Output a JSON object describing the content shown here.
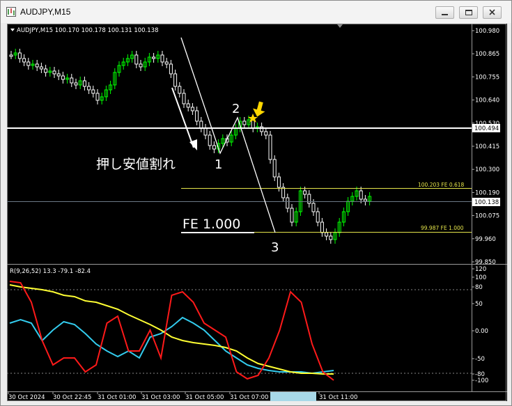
{
  "window": {
    "title": "AUDJPY,M15",
    "buttons": [
      "minimize",
      "maximize",
      "close"
    ]
  },
  "chart": {
    "info_line": "AUDJPY,M15  100.170 100.178 100.131 100.138",
    "price_axis_labels": [
      "100.980",
      "100.865",
      "100.755",
      "100.640",
      "100.530",
      "100.415",
      "100.300",
      "100.190",
      "100.075",
      "99.960",
      "99.850"
    ],
    "current_price": "100.138",
    "hline_price_label": "100.494",
    "fe_0618_label": "100.203  FE 0.618",
    "fe_1000_label": "99.987  FE 1.000",
    "annotation_text": "押し安値割れ",
    "wave_labels": [
      "1",
      "2",
      "3"
    ],
    "fe_text": "FE 1.000",
    "indicator_label": "R(9,26,52) 13.3 -79.1 -82.4",
    "indicator_axis_labels": [
      "120",
      "100",
      "80",
      "50",
      "0.00",
      "-50",
      "-80",
      "-100"
    ],
    "time_labels": [
      "30 Oct 2024",
      "30 Oct 22:45",
      "31 Oct 01:00",
      "31 Oct 03:00",
      "31 Oct 05:00",
      "31 Oct 07:00",
      "31 Oct 11:00"
    ],
    "colors": {
      "background": "#000000",
      "bull_candle": "#00ff00",
      "bear_candle": "#ffffff",
      "hline": "#ffffff",
      "fe_line": "#e6e64a",
      "rsi_fast": "#ff1a1a",
      "rsi_mid": "#ffff33",
      "rsi_slow": "#33ccee",
      "arrow": "#ffd700",
      "time_highlight": "#a8d8e8"
    }
  }
}
